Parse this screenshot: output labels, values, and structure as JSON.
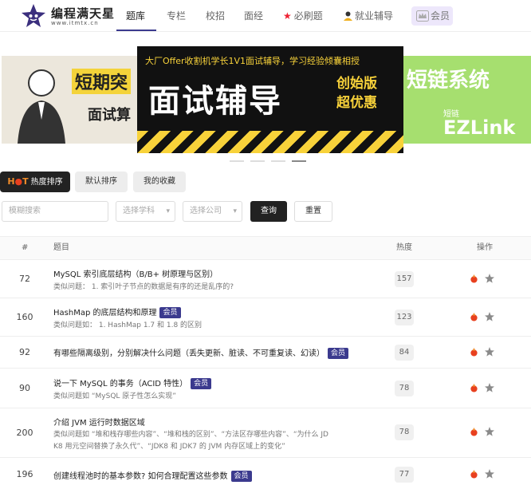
{
  "brand": {
    "name": "编程满天星",
    "url": "www.itmtx.cn"
  },
  "nav": {
    "items": [
      "题库",
      "专栏",
      "校招",
      "面经",
      "必刷题",
      "就业辅导"
    ],
    "vip": "会员"
  },
  "banner": {
    "left_text1": "短期突",
    "left_text2": "面试算",
    "main_sub": "大厂Offer收割机学长1V1面试辅导，学习经验倾囊相授",
    "main_big": "面试辅导",
    "main_edition": "创始版",
    "main_promo": "超优惠",
    "right_title": "短链系统",
    "right_sub": "短链",
    "right_brand": "EZLink"
  },
  "tabs": {
    "hot_label": "热度排序",
    "default": "默认排序",
    "fav": "我的收藏"
  },
  "filters": {
    "search_placeholder": "模糊搜索",
    "subject_placeholder": "选择学科",
    "company_placeholder": "选择公司",
    "query": "查询",
    "reset": "重置"
  },
  "table": {
    "headers": {
      "id": "#",
      "title": "题目",
      "heat": "热度",
      "ops": "操作"
    },
    "vip_badge": "会员",
    "rows": [
      {
        "id": "72",
        "title": "MySQL 索引底层结构（B/B+ 树原理与区别）",
        "similar": "类似问题：  1. 索引叶子节点的数据是有序的还是乱序的?",
        "heat": "157",
        "vip": false
      },
      {
        "id": "160",
        "title": "HashMap 的底层结构和原理",
        "similar": "类似问题如：  1. HashMap 1.7 和 1.8 的区别",
        "heat": "123",
        "vip": true
      },
      {
        "id": "92",
        "title": "有哪些隔离级别，分别解决什么问题（丢失更新、脏读、不可重复读、幻读）",
        "similar": "",
        "heat": "84",
        "vip": true
      },
      {
        "id": "90",
        "title": "说一下 MySQL 的事务（ACID 特性）",
        "similar": "类似问题如  “MySQL 原子性怎么实现”",
        "heat": "78",
        "vip": true
      },
      {
        "id": "200",
        "title": "介绍 JVM 运行时数据区域",
        "similar": "类似问题如  “堆和栈存哪些内容”、“堆和栈的区别”、“方法区存哪些内容”、“为什么 JD",
        "similar2": "K8 用元空间替换了永久代”、“JDK8 和 JDK7 的 JVM 内存区域上的变化”",
        "heat": "78",
        "vip": false
      },
      {
        "id": "196",
        "title": "创建线程池时的基本参数? 如何合理配置这些参数",
        "similar": "",
        "heat": "77",
        "vip": true
      }
    ]
  }
}
